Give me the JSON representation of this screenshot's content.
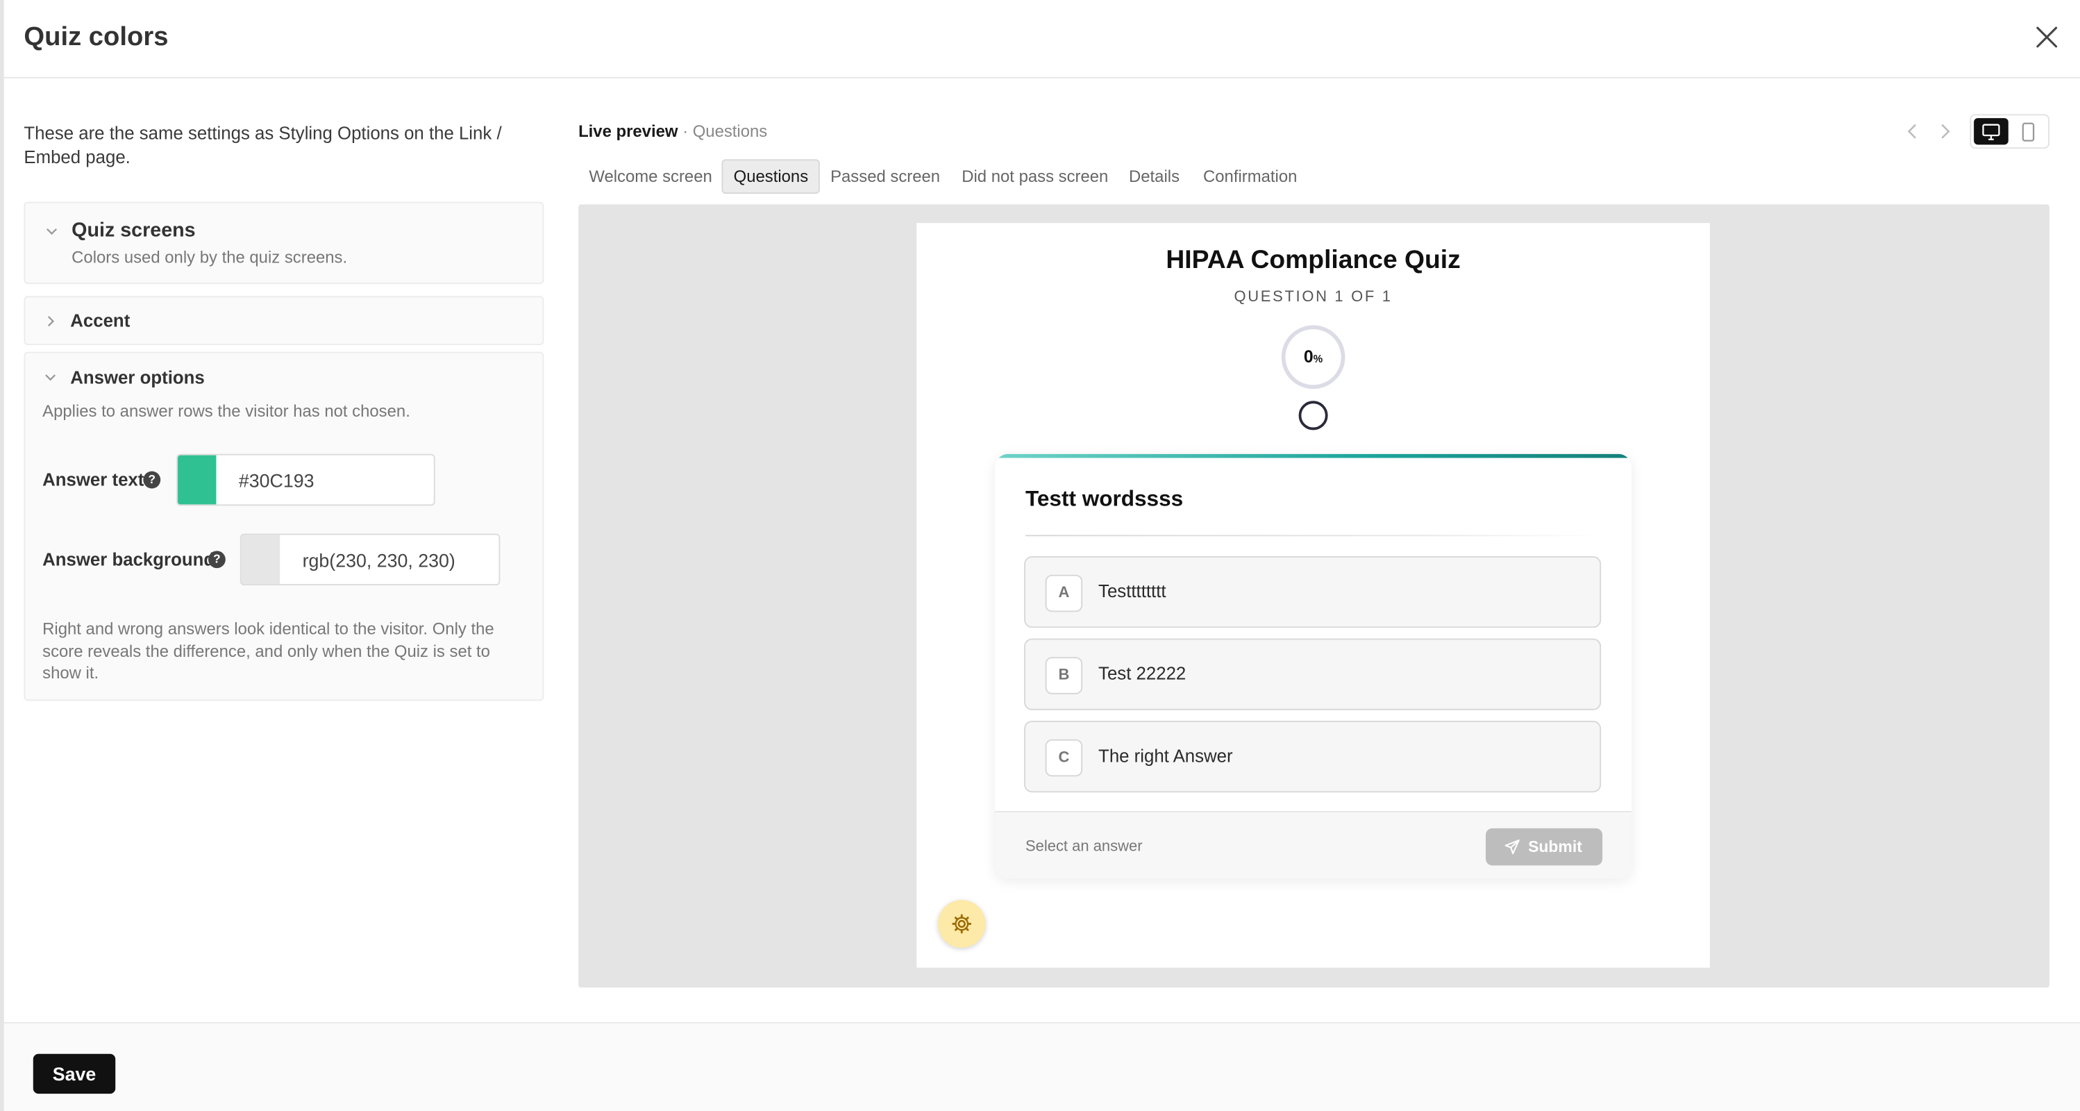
{
  "header": {
    "title": "Quiz colors"
  },
  "intro": "These are the same settings as Styling Options on the Link / Embed page.",
  "sections": {
    "quiz_screens": {
      "title": "Quiz screens",
      "description": "Colors used only by the quiz screens."
    },
    "accent": {
      "title": "Accent"
    },
    "answer_options": {
      "title": "Answer options",
      "description": "Applies to answer rows the visitor has not chosen.",
      "answer_text": {
        "label": "Answer text",
        "value": "#30C193",
        "swatch": "#30C193"
      },
      "answer_background": {
        "label": "Answer background",
        "value": "rgb(230, 230, 230)",
        "swatch": "#e6e6e6"
      },
      "note": "Right and wrong answers look identical to the visitor. Only the score reveals the difference, and only when the Quiz is set to show it."
    }
  },
  "preview": {
    "label": "Live preview",
    "sublabel": "· Questions",
    "tabs": [
      "Welcome screen",
      "Questions",
      "Passed screen",
      "Did not pass screen",
      "Details",
      "Confirmation"
    ],
    "active_tab": "Questions",
    "quiz": {
      "title": "HIPAA Compliance Quiz",
      "counter": "QUESTION 1 OF 1",
      "progress_value": "0",
      "progress_unit": "%",
      "question": "Testt wordssss",
      "answers": [
        {
          "letter": "A",
          "text": "Testttttttt"
        },
        {
          "letter": "B",
          "text": "Test 22222"
        },
        {
          "letter": "C",
          "text": "The right Answer"
        }
      ],
      "hint": "Select an answer",
      "submit_label": "Submit"
    }
  },
  "footer": {
    "save_label": "Save"
  },
  "colors": {
    "accent": "#1aa39a",
    "fab": "#fde9a8",
    "submit_disabled": "#bdbdbd"
  }
}
